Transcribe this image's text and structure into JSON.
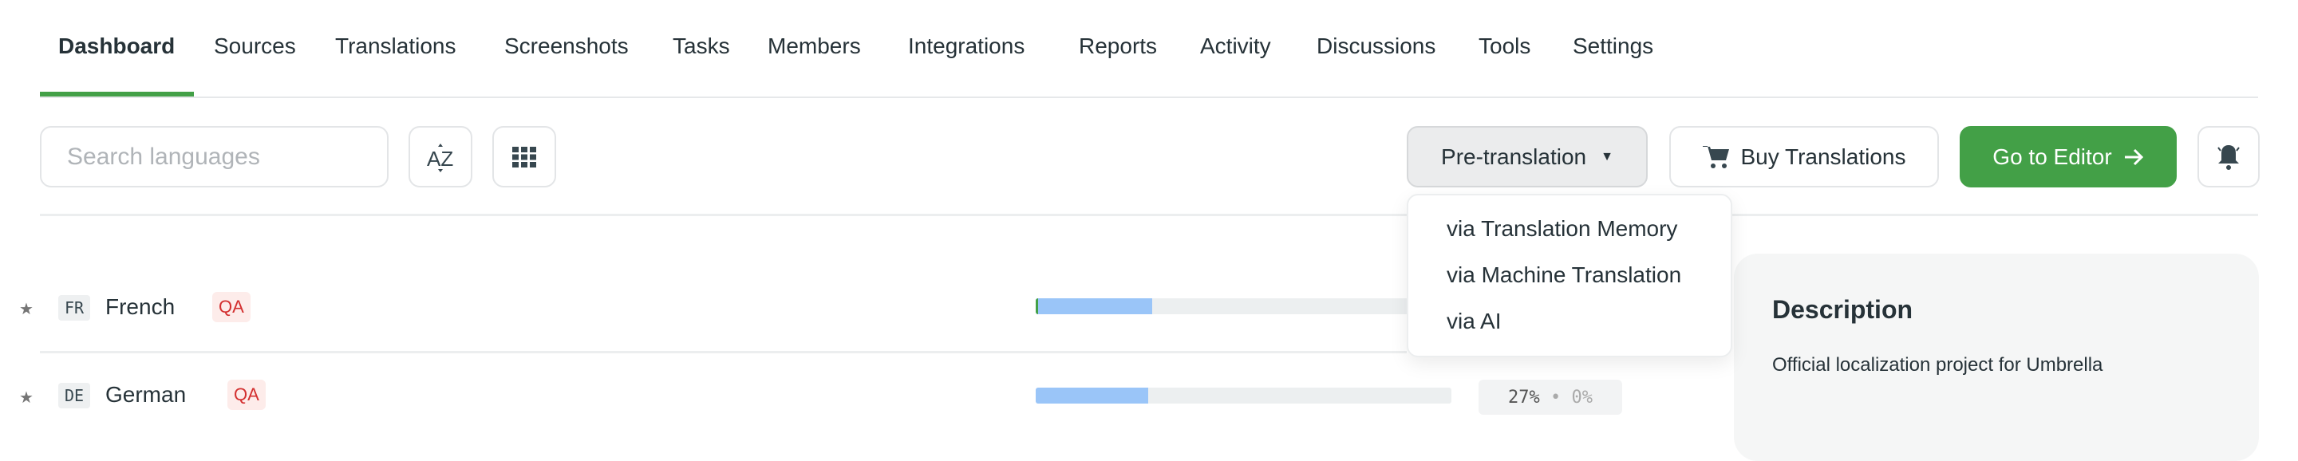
{
  "nav": {
    "items": [
      "Dashboard",
      "Sources",
      "Translations",
      "Screenshots",
      "Tasks",
      "Members",
      "Integrations",
      "Reports",
      "Activity",
      "Discussions",
      "Tools",
      "Settings"
    ],
    "active": "Dashboard"
  },
  "toolbar": {
    "search_placeholder": "Search languages",
    "sort_icon": "sort-az-icon",
    "view_icon": "grid-icon",
    "pretranslation_label": "Pre-translation",
    "buy_label": "Buy Translations",
    "editor_label": "Go to Editor",
    "accent": "#43a047"
  },
  "dropdown": {
    "items": [
      "via Translation Memory",
      "via Machine Translation",
      "via AI"
    ]
  },
  "languages": [
    {
      "code": "FR",
      "name": "French",
      "badge": "QA",
      "progress": 27
    },
    {
      "code": "DE",
      "name": "German",
      "badge": "QA",
      "progress": 27,
      "translated": "27%",
      "approved": "0%",
      "sep": "•"
    }
  ],
  "description": {
    "title": "Description",
    "text": "Official localization project for Umbrella"
  }
}
